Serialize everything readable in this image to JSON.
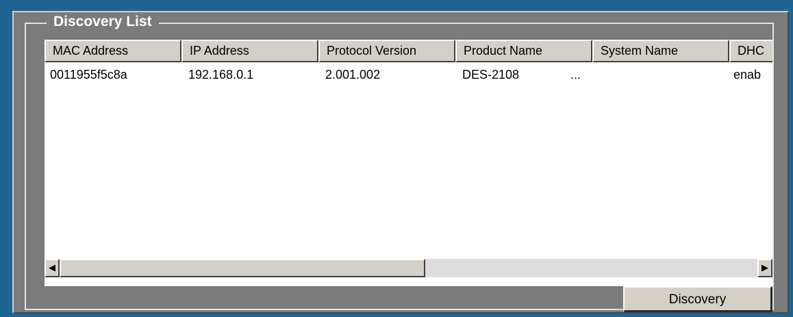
{
  "group": {
    "title": "Discovery List"
  },
  "table": {
    "columns": [
      "MAC Address",
      "IP Address",
      "Protocol Version",
      "Product Name",
      "System Name",
      "DHC"
    ],
    "rows": [
      {
        "mac": "0011955f5c8a",
        "ip": "192.168.0.1",
        "protocol": "2.001.002",
        "product": "DES-2108",
        "product_more": "...",
        "system_name": "",
        "dhcp": "enab"
      }
    ]
  },
  "scrollbar": {
    "left_arrow": "◀",
    "right_arrow": "▶"
  },
  "actions": {
    "discovery_label": "Discovery"
  },
  "colors": {
    "background": "#1f6593",
    "panel": "#7b7b7b",
    "button_face": "#d4d0c8"
  }
}
